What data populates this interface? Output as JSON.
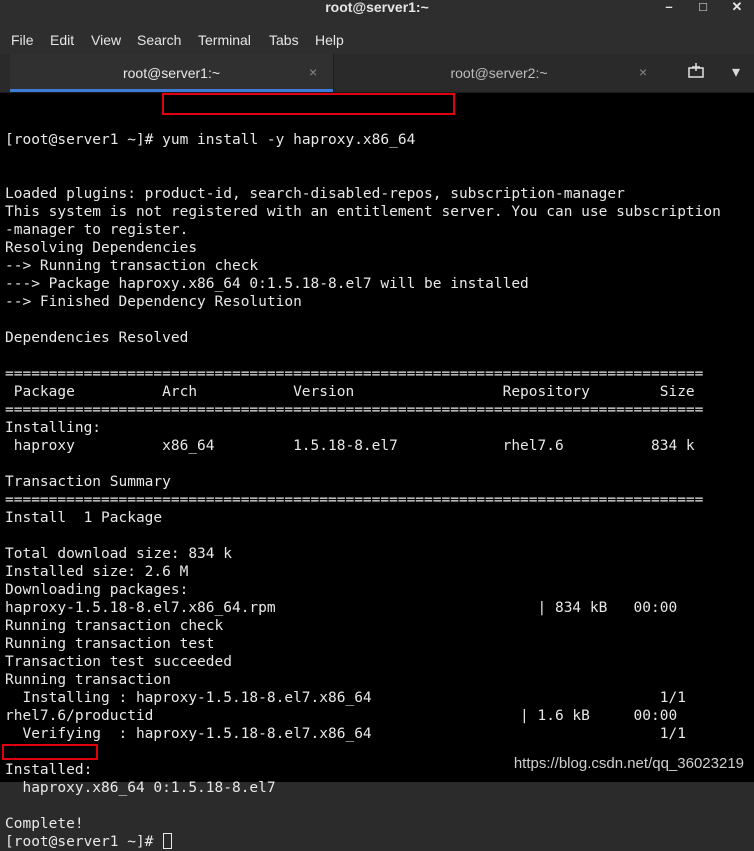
{
  "window": {
    "title": "root@server1:~",
    "minimize_glyph": "–",
    "maximize_glyph": "□",
    "close_glyph": "✕"
  },
  "menu": [
    "File",
    "Edit",
    "View",
    "Search",
    "Terminal",
    "Tabs",
    "Help"
  ],
  "tabs": [
    {
      "label": "root@server1:~",
      "close": "×",
      "active": true
    },
    {
      "label": "root@server2:~",
      "close": "×",
      "active": false
    }
  ],
  "tab_actions": {
    "new_tab_icon": "new-tab-icon",
    "dropdown_glyph": "▾"
  },
  "terminal": {
    "prompt": "[root@server1 ~]# ",
    "command": "yum install -y haproxy.x86_64",
    "output": [
      "Loaded plugins: product-id, search-disabled-repos, subscription-manager",
      "This system is not registered with an entitlement server. You can use subscription",
      "-manager to register.",
      "Resolving Dependencies",
      "--> Running transaction check",
      "---> Package haproxy.x86_64 0:1.5.18-8.el7 will be installed",
      "--> Finished Dependency Resolution",
      "",
      "Dependencies Resolved",
      "",
      "================================================================================",
      " Package          Arch           Version                 Repository        Size",
      "================================================================================",
      "Installing:",
      " haproxy          x86_64         1.5.18-8.el7            rhel7.6          834 k",
      "",
      "Transaction Summary",
      "================================================================================",
      "Install  1 Package",
      "",
      "Total download size: 834 k",
      "Installed size: 2.6 M",
      "Downloading packages:",
      "haproxy-1.5.18-8.el7.x86_64.rpm                              | 834 kB   00:00",
      "Running transaction check",
      "Running transaction test",
      "Transaction test succeeded",
      "Running transaction",
      "  Installing : haproxy-1.5.18-8.el7.x86_64                                 1/1",
      "rhel7.6/productid                                          | 1.6 kB     00:00",
      "  Verifying  : haproxy-1.5.18-8.el7.x86_64                                 1/1",
      "",
      "Installed:",
      "  haproxy.x86_64 0:1.5.18-8.el7",
      "",
      "Complete!"
    ],
    "final_prompt": "[root@server1 ~]# "
  },
  "watermark": "https://blog.csdn.net/qq_36023219",
  "colors": {
    "terminal_bg": "#000000",
    "terminal_fg": "#e8e8e8",
    "highlight": "#e0000f",
    "active_tab_accent": "#3d7bd6"
  }
}
